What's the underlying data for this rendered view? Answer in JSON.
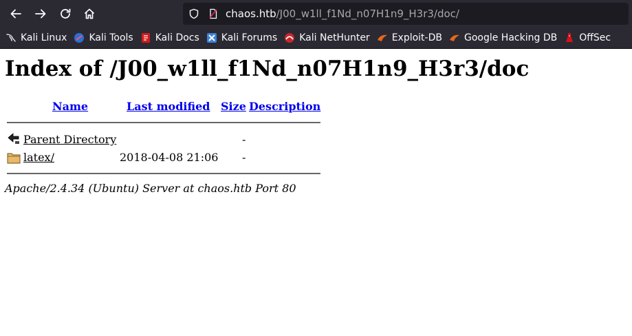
{
  "browser": {
    "url_host": "chaos.htb",
    "url_path": "/J00_w1ll_f1Nd_n07H1n9_H3r3/doc/",
    "nav_icons": [
      "arrow-left-icon",
      "arrow-right-icon",
      "reload-icon",
      "home-icon"
    ],
    "bookmarks": [
      {
        "label": "Kali Linux",
        "icon": "kali-dragon-icon"
      },
      {
        "label": "Kali Tools",
        "icon": "kali-tools-icon"
      },
      {
        "label": "Kali Docs",
        "icon": "kali-docs-icon"
      },
      {
        "label": "Kali Forums",
        "icon": "kali-forums-icon"
      },
      {
        "label": "Kali NetHunter",
        "icon": "nethunter-icon"
      },
      {
        "label": "Exploit-DB",
        "icon": "exploit-db-icon"
      },
      {
        "label": "Google Hacking DB",
        "icon": "ghdb-icon"
      },
      {
        "label": "OffSec",
        "icon": "offsec-icon"
      }
    ]
  },
  "page": {
    "title": "Index of /J00_w1ll_f1Nd_n07H1n9_H3r3/doc",
    "columns": {
      "name": "Name",
      "last_modified": "Last modified",
      "size": "Size",
      "description": "Description"
    },
    "rows": [
      {
        "icon": "parent-directory-icon",
        "name": "Parent Directory",
        "modified": "",
        "size": "-",
        "description": ""
      },
      {
        "icon": "folder-icon",
        "name": "latex/",
        "modified": "2018-04-08 21:06",
        "size": "-",
        "description": ""
      }
    ],
    "footer": "Apache/2.4.34 (Ubuntu) Server at chaos.htb Port 80"
  },
  "colors": {
    "chrome_bg": "#2b2a33",
    "urlbar_bg": "#1c1b22",
    "link_unvisited": "#0000ee",
    "link_visited": "#551a8b"
  }
}
